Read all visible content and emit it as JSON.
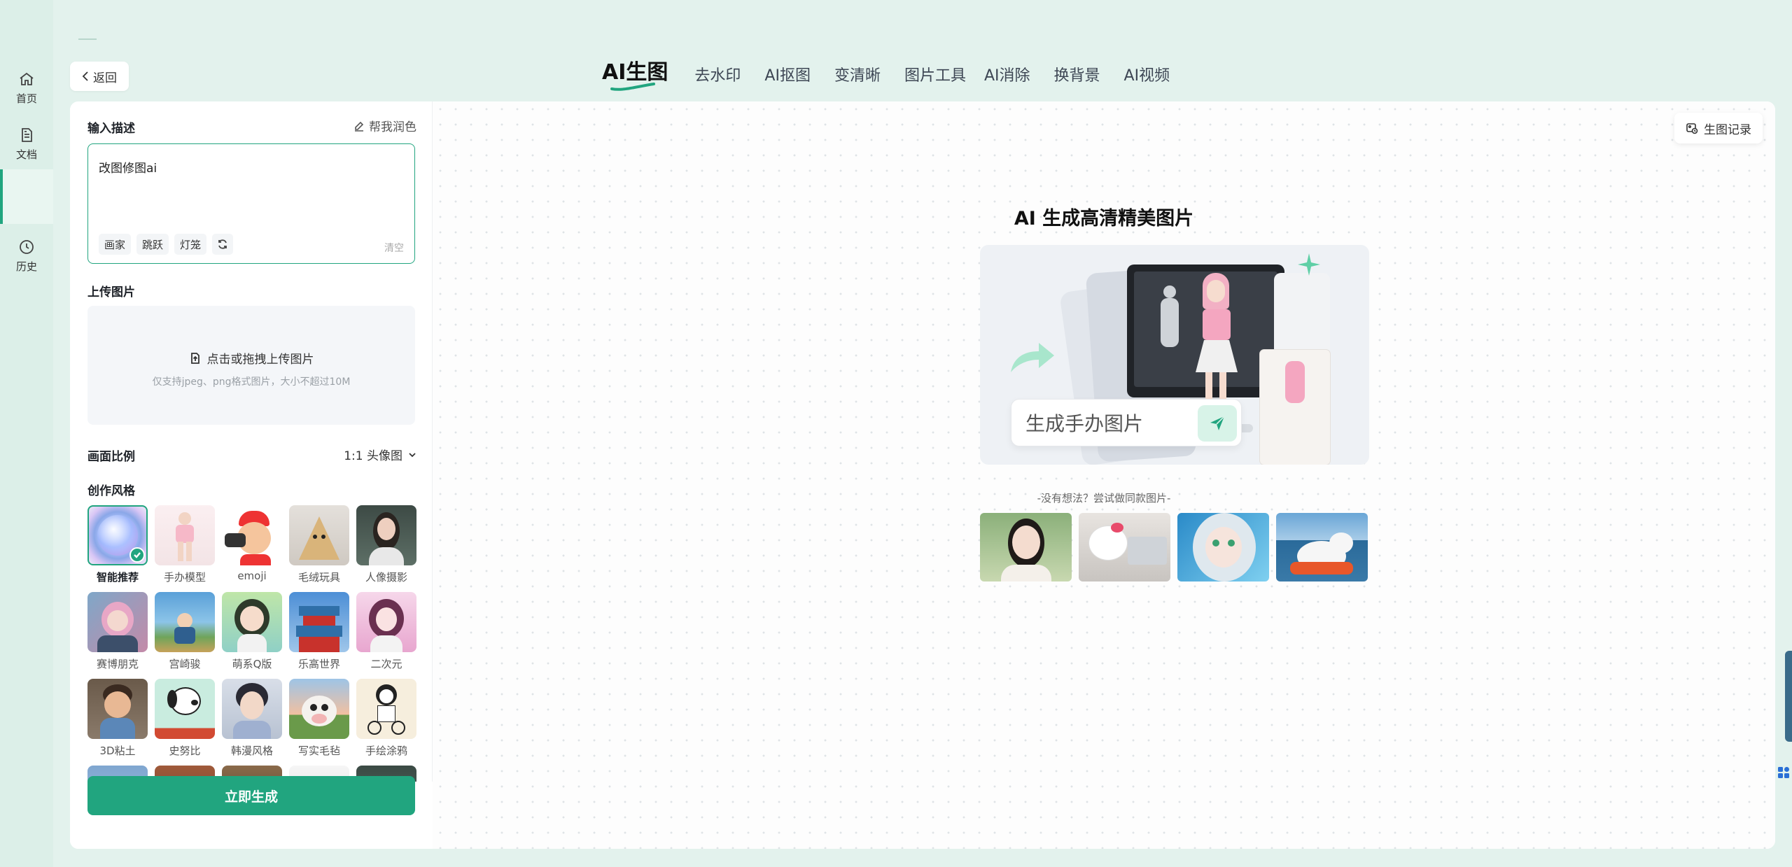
{
  "rail": {
    "items": [
      {
        "label": "首页",
        "icon": "home-icon"
      },
      {
        "label": "文档",
        "icon": "document-icon"
      },
      {
        "label": "",
        "icon": ""
      },
      {
        "label": "历史",
        "icon": "clock-icon"
      }
    ]
  },
  "header": {
    "back_label": "返回",
    "tabs": [
      "AI生图",
      "去水印",
      "AI抠图",
      "变清晰",
      "图片工具",
      "AI消除",
      "换背景",
      "AI视频"
    ],
    "active_tab": "AI生图"
  },
  "sidebar": {
    "prompt_title": "输入描述",
    "polish_label": "帮我润色",
    "prompt_value": "改图修图ai",
    "chips": [
      "画家",
      "跳跃",
      "灯笼"
    ],
    "clear_label": "清空",
    "upload_title": "上传图片",
    "upload_text": "点击或拖拽上传图片",
    "upload_hint": "仅支持jpeg、png格式图片，大小不超过10M",
    "ratio_title": "画面比例",
    "ratio_value": "1:1 头像图",
    "style_title": "创作风格",
    "styles": [
      {
        "label": "智能推荐",
        "selected": true
      },
      {
        "label": "手办模型"
      },
      {
        "label": "emoji"
      },
      {
        "label": "毛绒玩具"
      },
      {
        "label": "人像摄影"
      },
      {
        "label": "赛博朋克"
      },
      {
        "label": "宫崎骏"
      },
      {
        "label": "萌系Q版"
      },
      {
        "label": "乐高世界"
      },
      {
        "label": "二次元"
      },
      {
        "label": "3D粘土"
      },
      {
        "label": "史努比"
      },
      {
        "label": "韩漫风格"
      },
      {
        "label": "写实毛毡"
      },
      {
        "label": "手绘涂鸦"
      }
    ],
    "generate_label": "立即生成"
  },
  "canvas": {
    "history_label": "生图记录",
    "hero_title": "AI 生成高清精美图片",
    "hero_input_text": "生成手办图片",
    "hint": "-没有想法？尝试做同款图片-"
  },
  "colors": {
    "accent": "#21a57f",
    "background": "#e3f2ed"
  }
}
